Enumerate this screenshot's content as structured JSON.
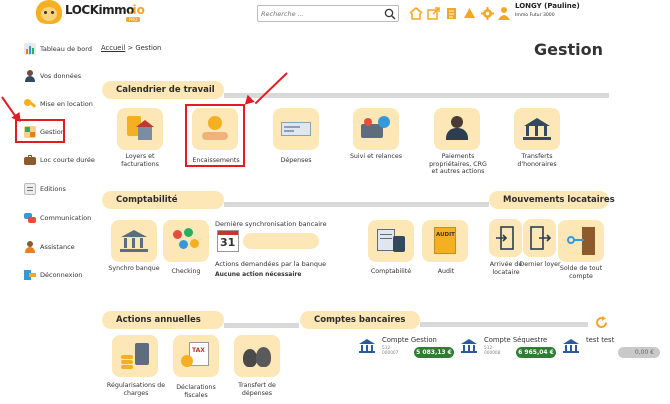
{
  "header": {
    "logo_text": "LOCKimmo",
    "logo_suffix": ".io",
    "logo_tag": "PRO",
    "search_placeholder": "Recherche ...",
    "user_name": "LONGY (Pauline)",
    "user_company": "Immo Futur 3000",
    "icons": [
      "search-icon",
      "home-icon",
      "external-link-icon",
      "document-icon",
      "bell-icon",
      "gear-icon",
      "user-icon"
    ]
  },
  "sidebar": {
    "items": [
      {
        "label": "Tableau de bord",
        "icon": "dashboard-icon"
      },
      {
        "label": "Vos données",
        "icon": "person-icon"
      },
      {
        "label": "Mise en location",
        "icon": "key-icon"
      },
      {
        "label": "Gestion",
        "icon": "management-icon"
      },
      {
        "label": "Loc courte durée",
        "icon": "suitcase-icon"
      },
      {
        "label": "Editions",
        "icon": "editions-icon"
      },
      {
        "label": "Communication",
        "icon": "chat-icon"
      },
      {
        "label": "Assistance",
        "icon": "assistance-icon"
      },
      {
        "label": "Déconnexion",
        "icon": "logout-icon"
      }
    ]
  },
  "breadcrumb": {
    "home": "Accueil",
    "separator": ">",
    "current": "Gestion"
  },
  "page_title": "Gestion",
  "sections": {
    "calendrier": {
      "title": "Calendrier de travail",
      "tiles": [
        "Loyers et facturations",
        "Encaissements",
        "Dépenses",
        "Suivi et relances",
        "Paiements propriétaires, CRG et autres actions",
        "Transferts d'honoraires"
      ]
    },
    "comptabilite": {
      "title": "Comptabilité",
      "tiles": [
        "Synchro banque",
        "Checking",
        "Comptabilité",
        "Audit"
      ],
      "sync_label": "Dernière synchronisation bancaire",
      "calendar_day": "31",
      "actions_label": "Actions demandées par la banque",
      "actions_value": "Aucune action nécessaire",
      "audit_tile_text": "AUDIT"
    },
    "mouvements": {
      "title": "Mouvements locataires",
      "tiles": [
        "Arrivée de locataire",
        "Dernier loyer",
        "Solde de tout compte"
      ]
    },
    "actions_annuelles": {
      "title": "Actions annuelles",
      "tiles": [
        "Régularisations de charges",
        "Déclarations fiscales",
        "Transfert de dépenses"
      ],
      "tax_tile_text": "TAX"
    },
    "comptes": {
      "title": "Comptes bancaires",
      "accounts": [
        {
          "name": "Compte Gestion",
          "num1": "512-",
          "num2": "000007",
          "amount": "5 083,13 €",
          "color": "#2e7d32"
        },
        {
          "name": "Compte Séquestre",
          "num1": "512-",
          "num2": "000008",
          "amount": "6 965,04 €",
          "color": "#2e7d32"
        },
        {
          "name": "test test",
          "num1": "",
          "num2": "",
          "amount": "0,00 €",
          "color": "#c9c9c9"
        }
      ]
    }
  }
}
